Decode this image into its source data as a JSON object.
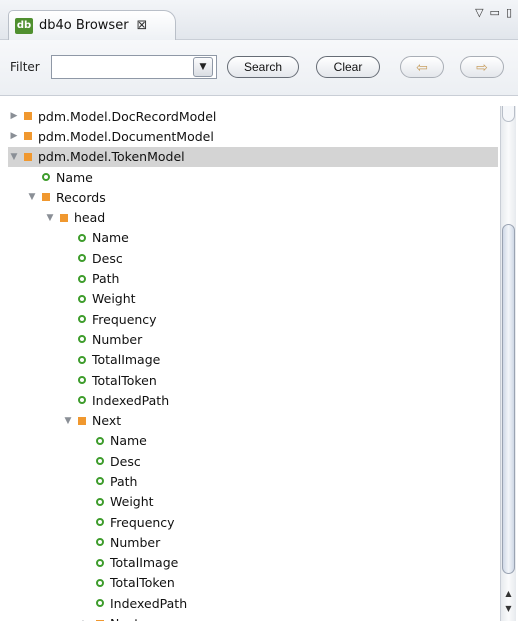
{
  "view": {
    "icon_text": "db",
    "title": "db4o Browser",
    "close_glyph": "⊠",
    "menu_glyphs": [
      "▽",
      "▭",
      "▯"
    ]
  },
  "filter": {
    "label": "Filter",
    "value": "",
    "dropdown_glyph": "▼",
    "search_label": "Search",
    "clear_label": "Clear",
    "back_glyph": "⇦",
    "forward_glyph": "⇨"
  },
  "colors": {
    "object_node": "#f0982f",
    "field_node": "#3e9c2c",
    "selected_row": "#d4d4d4"
  },
  "tree": {
    "rows": [
      {
        "label": "pdm.Model.DocRecordModel",
        "type": "object",
        "depth": 0,
        "expanded": false,
        "selected": false
      },
      {
        "label": "pdm.Model.DocumentModel",
        "type": "object",
        "depth": 0,
        "expanded": false,
        "selected": false
      },
      {
        "label": "pdm.Model.TokenModel",
        "type": "object",
        "depth": 0,
        "expanded": true,
        "selected": true
      },
      {
        "label": "Name",
        "type": "field",
        "depth": 1
      },
      {
        "label": "Records",
        "type": "object",
        "depth": 1,
        "expanded": true
      },
      {
        "label": "head",
        "type": "object",
        "depth": 2,
        "expanded": true
      },
      {
        "label": "Name",
        "type": "field",
        "depth": 3
      },
      {
        "label": "Desc",
        "type": "field",
        "depth": 3
      },
      {
        "label": "Path",
        "type": "field",
        "depth": 3
      },
      {
        "label": "Weight",
        "type": "field",
        "depth": 3
      },
      {
        "label": "Frequency",
        "type": "field",
        "depth": 3
      },
      {
        "label": "Number",
        "type": "field",
        "depth": 3
      },
      {
        "label": "TotalImage",
        "type": "field",
        "depth": 3
      },
      {
        "label": "TotalToken",
        "type": "field",
        "depth": 3
      },
      {
        "label": "IndexedPath",
        "type": "field",
        "depth": 3
      },
      {
        "label": "Next",
        "type": "object",
        "depth": 3,
        "expanded": true
      },
      {
        "label": "Name",
        "type": "field",
        "depth": 4
      },
      {
        "label": "Desc",
        "type": "field",
        "depth": 4
      },
      {
        "label": "Path",
        "type": "field",
        "depth": 4
      },
      {
        "label": "Weight",
        "type": "field",
        "depth": 4
      },
      {
        "label": "Frequency",
        "type": "field",
        "depth": 4
      },
      {
        "label": "Number",
        "type": "field",
        "depth": 4
      },
      {
        "label": "TotalImage",
        "type": "field",
        "depth": 4
      },
      {
        "label": "TotalToken",
        "type": "field",
        "depth": 4
      },
      {
        "label": "IndexedPath",
        "type": "field",
        "depth": 4
      },
      {
        "label": "Next",
        "type": "object",
        "depth": 4,
        "expanded": false
      }
    ]
  },
  "scrollbar": {
    "up_glyph": "▲",
    "down_glyph": "▼"
  }
}
